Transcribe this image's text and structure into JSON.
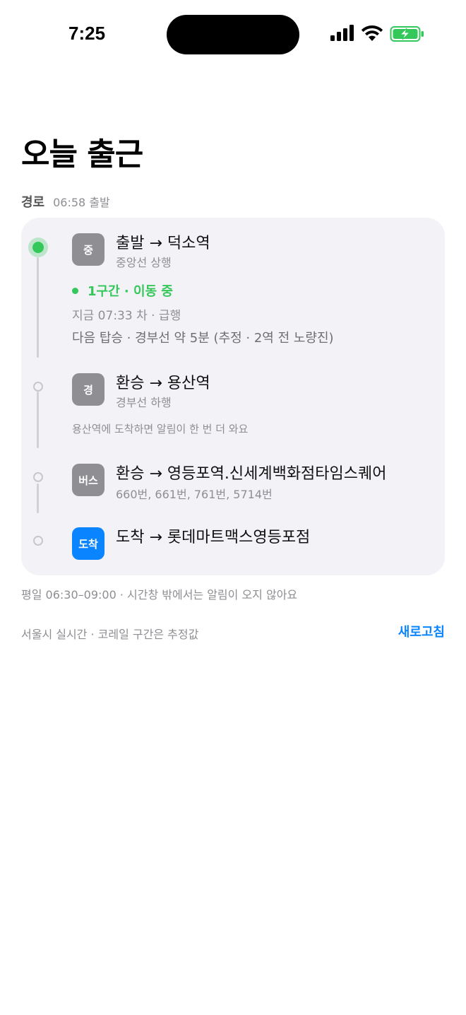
{
  "status_bar": {
    "time": "7:25",
    "icons": [
      "signal-icon",
      "wifi-icon",
      "battery-charging-icon"
    ]
  },
  "title": "오늘 출근",
  "route": {
    "label": "경로",
    "departure": "06:58 출발"
  },
  "steps": [
    {
      "badge": "중",
      "title": "출발 → 덕소역",
      "subtitle": "중앙선 상행",
      "status": "1구간 · 이동 중",
      "now": "지금 07:33 차 · 급행",
      "next": "다음 탑승 · 경부선 약 5분 (추정 · 2역 전 노량진)"
    },
    {
      "badge": "경",
      "title": "환승 → 용산역",
      "subtitle": "경부선 하행",
      "note": "용산역에 도착하면 알림이 한 번 더 와요"
    },
    {
      "badge": "버스",
      "title": "환승 → 영등포역.신세계백화점타임스퀘어",
      "subtitle": "660번, 661번, 761번, 5714번"
    },
    {
      "badge": "도착",
      "title": "도착 → 롯데마트맥스영등포점"
    }
  ],
  "footer": {
    "window_note": "평일 06:30–09:00 · 시간창 밖에서는 알림이 오지 않아요",
    "source_note": "서울시 실시간 · 코레일 구간은 추정값",
    "refresh_label": "새로고침"
  },
  "colors": {
    "accent_green": "#34c759",
    "accent_blue": "#0a84ff",
    "card_bg": "#f2f2f7",
    "badge_gray": "#8e8e93"
  }
}
